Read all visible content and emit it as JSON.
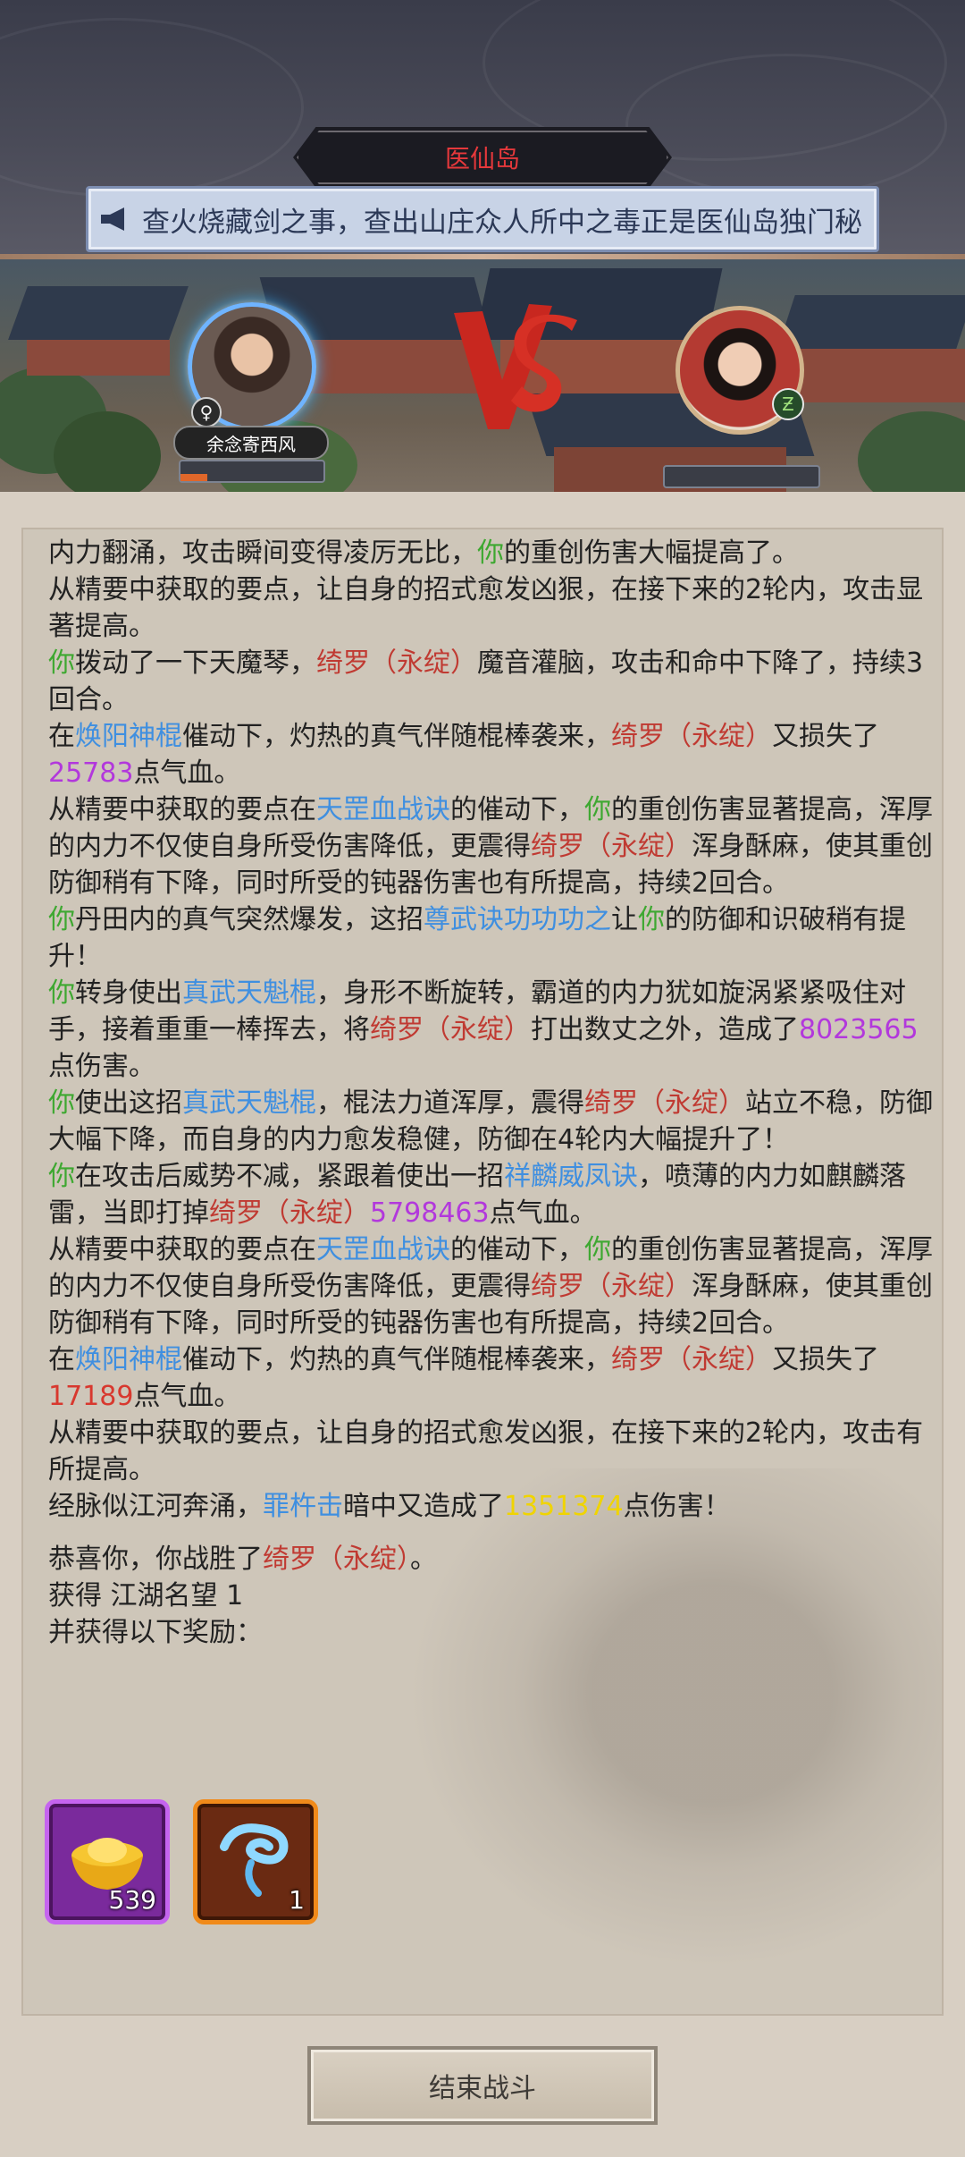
{
  "header": {
    "location": "医仙岛",
    "ticker": "查火烧藏剑之事，查出山庄众人所中之毒正是医仙岛独门秘"
  },
  "battle": {
    "player_name": "余念寄西风",
    "player_gender_icon": "♀"
  },
  "log": {
    "l1": [
      "内力翻涌，攻击瞬间变得凌厉无比，",
      "你",
      "的重创伤害大幅提高了。"
    ],
    "l2": [
      "从精要中获取的要点，让自身的招式愈发凶狠，在接下来的2轮内，攻击显著提高。"
    ],
    "l3": [
      "你",
      "拨动了一下天魔琴，",
      "绮罗（永绽）",
      "魔音灌脑，攻击和命中下降了，持续3回合。"
    ],
    "l4": [
      "在",
      "焕阳神棍",
      "催动下，灼热的真气伴随棍棒袭来，",
      "绮罗（永绽）",
      "又损失了",
      "25783",
      "点气血。"
    ],
    "l5": [
      "从精要中获取的要点在",
      "天罡血战诀",
      "的催动下，",
      "你",
      "的重创伤害显著提高，浑厚的内力不仅使自身所受伤害降低，更震得",
      "绮罗（永绽）",
      "浑身酥麻，使其重创防御稍有下降，同时所受的钝器伤害也有所提高，持续2回合。"
    ],
    "l6": [
      "你",
      "丹田内的真气突然爆发，这招",
      "尊武诀功功功之",
      "让",
      "你",
      "的防御和识破稍有提升！"
    ],
    "l7": [
      "你",
      "转身使出",
      "真武天魁棍",
      "，身形不断旋转，霸道的内力犹如旋涡紧紧吸住对手，接着重重一棒挥去，将",
      "绮罗（永绽）",
      "打出数丈之外，造成了",
      "8023565",
      "点伤害。"
    ],
    "l8": [
      "你",
      "使出这招",
      "真武天魁棍",
      "，棍法力道浑厚，震得",
      "绮罗（永绽）",
      "站立不稳，防御大幅下降，而自身的内力愈发稳健，防御在4轮内大幅提升了！"
    ],
    "l9": [
      "你",
      "在攻击后威势不减，紧跟着使出一招",
      "祥麟威凤诀",
      "，喷薄的内力如麒麟落雷，当即打掉",
      "绮罗（永绽）",
      "5798463",
      "点气血。"
    ],
    "l10": [
      "从精要中获取的要点在",
      "天罡血战诀",
      "的催动下，",
      "你",
      "的重创伤害显著提高，浑厚的内力不仅使自身所受伤害降低，更震得",
      "绮罗（永绽）",
      "浑身酥麻，使其重创防御稍有下降，同时所受的钝器伤害也有所提高，持续2回合。"
    ],
    "l11": [
      "在",
      "焕阳神棍",
      "催动下，灼热的真气伴随棍棒袭来，",
      "绮罗（永绽）",
      "又损失了",
      "17189",
      "点气血。"
    ],
    "l12": [
      "从精要中获取的要点，让自身的招式愈发凶狠，在接下来的2轮内，攻击有所提高。"
    ],
    "l13": [
      "经脉似江河奔涌，",
      "罪杵击",
      "暗中又造成了",
      "1351374",
      "点伤害！"
    ],
    "l14": [
      "恭喜你，你战胜了",
      "绮罗（永绽）",
      "。"
    ],
    "l15": [
      "获得 江湖名望 1"
    ],
    "l16": [
      "并获得以下奖励："
    ]
  },
  "rewards": [
    {
      "icon": "gold-ingot-icon",
      "qty": "539"
    },
    {
      "icon": "blue-cloud-item-icon",
      "qty": "1"
    }
  ],
  "end_button": "结束战斗",
  "colors": {
    "you": "#3ea831",
    "enemy": "#c03a32",
    "skill": "#3f8fe0",
    "damage": "#b238dc",
    "hp_loss": "#d8382e",
    "extra": "#f0d400"
  }
}
